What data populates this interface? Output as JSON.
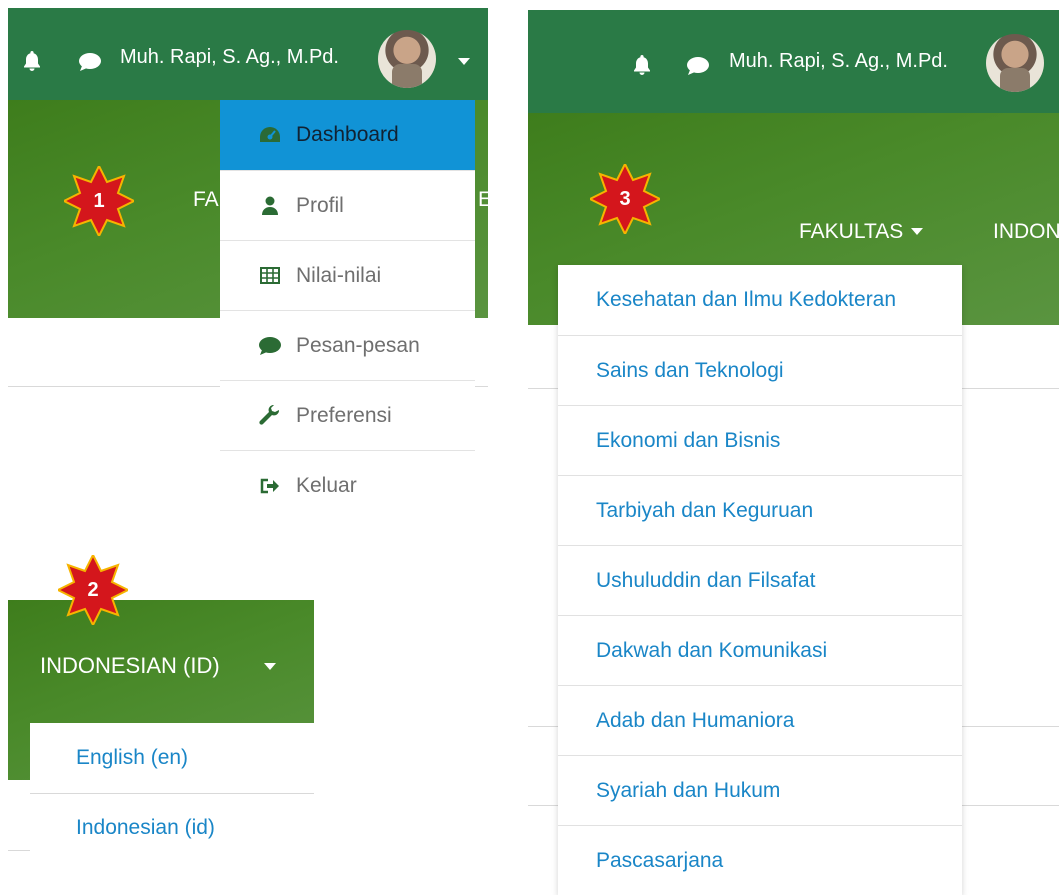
{
  "user": {
    "name": "Muh. Rapi, S. Ag., M.Pd."
  },
  "steps": {
    "one": "1",
    "two": "2",
    "three": "3"
  },
  "user_menu": {
    "items": [
      {
        "label": "Dashboard",
        "icon": "dashboard-icon"
      },
      {
        "label": "Profil",
        "icon": "user-icon"
      },
      {
        "label": "Nilai-nilai",
        "icon": "table-icon"
      },
      {
        "label": "Pesan-pesan",
        "icon": "chat-icon"
      },
      {
        "label": "Preferensi",
        "icon": "wrench-icon"
      },
      {
        "label": "Keluar",
        "icon": "sign-out-icon"
      }
    ]
  },
  "nav": {
    "fakultas_partial": "FA",
    "partial_right": "ES",
    "fakultas": "FAKULTAS",
    "indonesian_partial": "INDON"
  },
  "language": {
    "current": "INDONESIAN (ID)",
    "options": [
      "English (en)",
      "Indonesian (id)"
    ]
  },
  "fakultas_menu": {
    "items": [
      "Kesehatan dan Ilmu Kedokteran",
      "Sains dan Teknologi",
      "Ekonomi dan Bisnis",
      "Tarbiyah dan Keguruan",
      "Ushuluddin dan Filsafat",
      "Dakwah dan Komunikasi",
      "Adab dan Humaniora",
      "Syariah dan Hukum",
      "Pascasarjana"
    ]
  },
  "colors": {
    "header_green": "#2a7a46",
    "hero_green": "#4a8a2a",
    "active_blue": "#1193d6",
    "link_blue": "#1a86c7",
    "badge_red": "#d4161c"
  }
}
